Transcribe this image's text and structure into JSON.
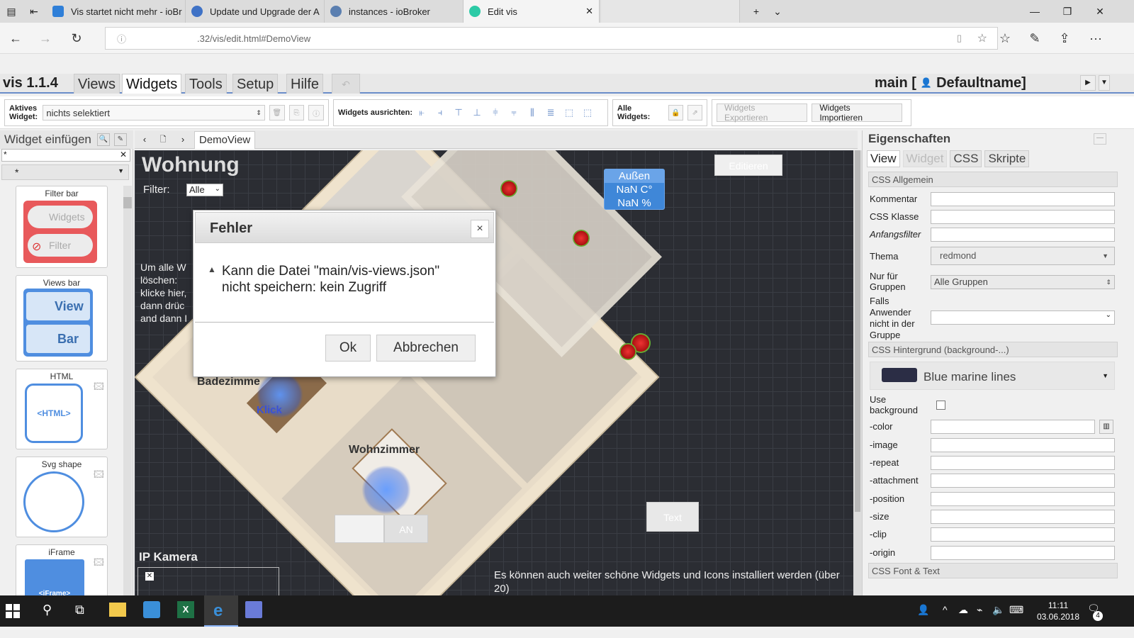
{
  "browser": {
    "tabs": [
      {
        "title": "Vis startet nicht mehr - ioBr",
        "fav_color": "#2f7fd8"
      },
      {
        "title": "Update und Upgrade der A",
        "fav_color": "#3f72c6"
      },
      {
        "title": "instances - ioBroker",
        "fav_color": "#5b7fb0"
      },
      {
        "title": "Edit vis",
        "fav_color": "#2ccaa6"
      }
    ],
    "url": ".32/vis/edit.html#DemoView",
    "new_tab": "+",
    "more": "···"
  },
  "vis": {
    "version": "vis 1.1.4",
    "menu": [
      "Views",
      "Widgets",
      "Tools",
      "Setup",
      "Hilfe"
    ],
    "project": "main [",
    "user": "Defaultname]"
  },
  "toolbar": {
    "active_widget_label": "Aktives Widget:",
    "active_widget_value": "nichts selektiert",
    "align_label": "Widgets ausrichten:",
    "all_widgets_label": "Alle Widgets:",
    "export_label": "Widgets Exportieren",
    "import_label": "Widgets Importieren"
  },
  "left_panel": {
    "title": "Widget einfügen",
    "filter_value": "*",
    "set_value": "*",
    "widgets": [
      {
        "name": "Filter bar",
        "btn1": "Widgets",
        "btn2": "Filter"
      },
      {
        "name": "Views bar",
        "btn1": "View",
        "btn2": "Bar"
      },
      {
        "name": "HTML",
        "inner": "<HTML>"
      },
      {
        "name": "Svg shape"
      },
      {
        "name": "iFrame",
        "inner": "<iFrame>"
      }
    ]
  },
  "view": {
    "tab": "DemoView",
    "title": "Wohnung",
    "filter_label": "Filter:",
    "filter_value": "Alle",
    "edit_button": "Editieren",
    "weather": {
      "title": "Außen",
      "temp": "NaN C°",
      "hum": "NaN %"
    },
    "info_lines": [
      "Um alle W",
      "löschen:",
      "klicke hier,",
      "dann drüc",
      "and dann I"
    ],
    "bathroom": "Badezimme",
    "click": "Klick",
    "living": "Wohnzimmer",
    "an": "AN",
    "text_widget": "Text",
    "camera": "IP Kamera",
    "footer_note": "Es können auch weiter schöne Widgets und Icons installiert werden (über 20)"
  },
  "right_panel": {
    "title": "Eigenschaften",
    "tabs": [
      "View",
      "Widget",
      "CSS",
      "Skripte"
    ],
    "css_general": "CSS Allgemein",
    "fields": [
      {
        "label": "Kommentar",
        "value": ""
      },
      {
        "label": "CSS Klasse",
        "value": ""
      },
      {
        "label": "Anfangsfilter",
        "value": ""
      }
    ],
    "theme_label": "Thema",
    "theme_value": "redmond",
    "groups_label": "Nur für Gruppen",
    "groups_value": "Alle Gruppen",
    "notingroup_label": "Falls Anwender nicht in der Gruppe",
    "bg_section": "CSS Hintergrund (background-...)",
    "bg_preset": "Blue marine lines",
    "use_bg_label": "Use background",
    "bg_fields": [
      "-color",
      "-image",
      "-repeat",
      "-attachment",
      "-position",
      "-size",
      "-clip",
      "-origin"
    ],
    "font_section": "CSS Font & Text"
  },
  "dialog": {
    "title": "Fehler",
    "close": "×",
    "message_line1": "Kann die Datei \"main/vis-views.json\"",
    "message_line2": "nicht speichern: kein Zugriff",
    "ok": "Ok",
    "cancel": "Abbrechen"
  },
  "taskbar": {
    "time": "11:11",
    "date": "03.06.2018",
    "notif_count": "4"
  }
}
